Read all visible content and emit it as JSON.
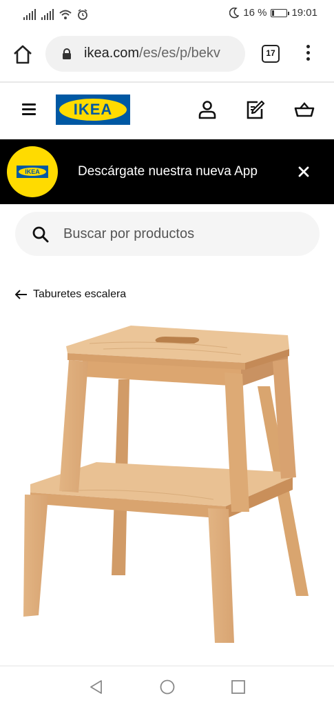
{
  "status_bar": {
    "battery": "16 %",
    "battery_level": 0.16,
    "time": "19:01"
  },
  "browser": {
    "url_host": "ikea.com",
    "url_path": "/es/es/p/bekv",
    "tab_count": "17"
  },
  "header": {
    "logo_text": "IKEA"
  },
  "app_banner": {
    "logo_text": "IKEA",
    "message": "Descárgate nuestra nueva App"
  },
  "search": {
    "placeholder": "Buscar por productos"
  },
  "breadcrumb": {
    "label": "Taburetes escalera"
  },
  "colors": {
    "brand_blue": "#0058a3",
    "brand_yellow": "#ffdb00",
    "banner_bg": "#000000"
  },
  "icons": {
    "home": "home-icon",
    "lock": "lock-icon",
    "menu": "hamburger-menu-icon",
    "profile": "user-icon",
    "shopping_list": "shopping-list-icon",
    "cart": "shopping-bag-icon",
    "close": "close-icon",
    "search": "search-icon",
    "back": "arrow-left-icon"
  }
}
